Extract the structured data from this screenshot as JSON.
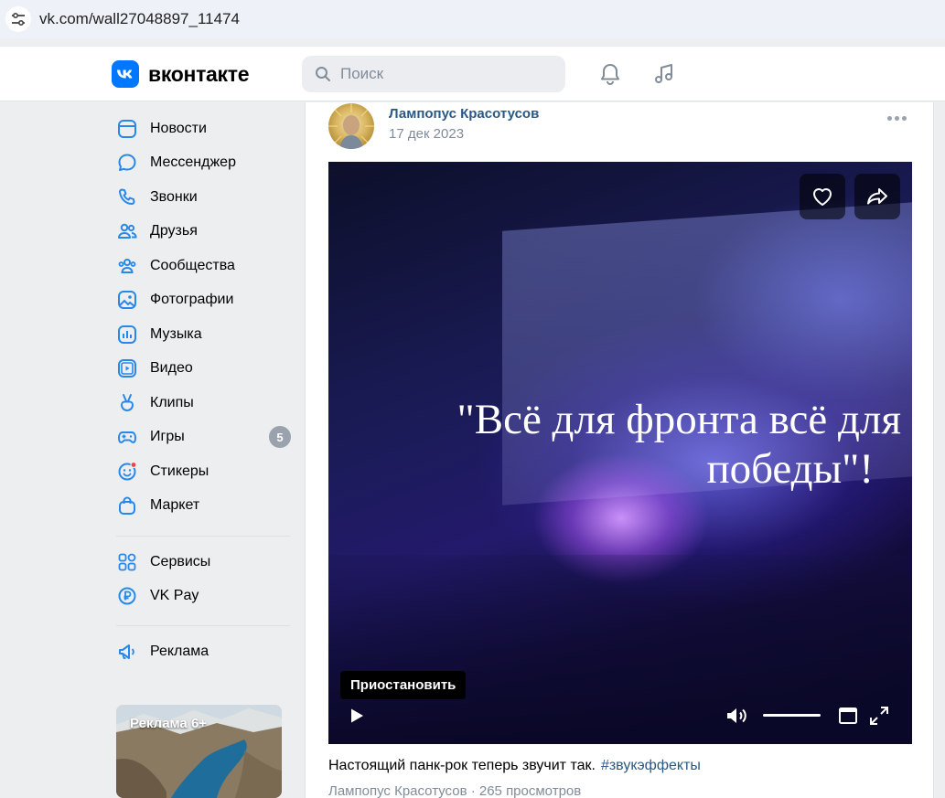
{
  "browser": {
    "url": "vk.com/wall27048897_11474"
  },
  "header": {
    "logo_text": "вконтакте",
    "brand_color": "#0077ff",
    "search_placeholder": "Поиск",
    "icons": [
      "bell-icon",
      "music-icon"
    ]
  },
  "sidebar": {
    "items": [
      {
        "label": "Новости",
        "icon": "news-icon"
      },
      {
        "label": "Мессенджер",
        "icon": "messenger-icon"
      },
      {
        "label": "Звонки",
        "icon": "phone-icon"
      },
      {
        "label": "Друзья",
        "icon": "friends-icon"
      },
      {
        "label": "Сообщества",
        "icon": "communities-icon"
      },
      {
        "label": "Фотографии",
        "icon": "photos-icon"
      },
      {
        "label": "Музыка",
        "icon": "music-icon"
      },
      {
        "label": "Видео",
        "icon": "video-icon"
      },
      {
        "label": "Клипы",
        "icon": "clips-icon"
      },
      {
        "label": "Игры",
        "icon": "games-icon",
        "badge": "5"
      },
      {
        "label": "Стикеры",
        "icon": "stickers-icon"
      },
      {
        "label": "Маркет",
        "icon": "market-icon"
      }
    ],
    "secondary": [
      {
        "label": "Сервисы",
        "icon": "services-icon"
      },
      {
        "label": "VK Pay",
        "icon": "vkpay-icon"
      }
    ],
    "ads": {
      "label": "Реклама",
      "icon": "megaphone-icon"
    },
    "ad_banner_label": "Реклама 6+"
  },
  "post": {
    "author": "Лампопус Красотусов",
    "date": "17 дек 2023",
    "video": {
      "caption_line1": "\"Всё для фронта всё для",
      "caption_line2": "победы\"!",
      "tooltip": "Приостановить",
      "volume_level": 1.0
    },
    "text": "Настоящий панк-рок теперь звучит так.",
    "hashtag": "#звукэффекты",
    "meta": "Лампопус Красотусов · 265 просмотров"
  }
}
